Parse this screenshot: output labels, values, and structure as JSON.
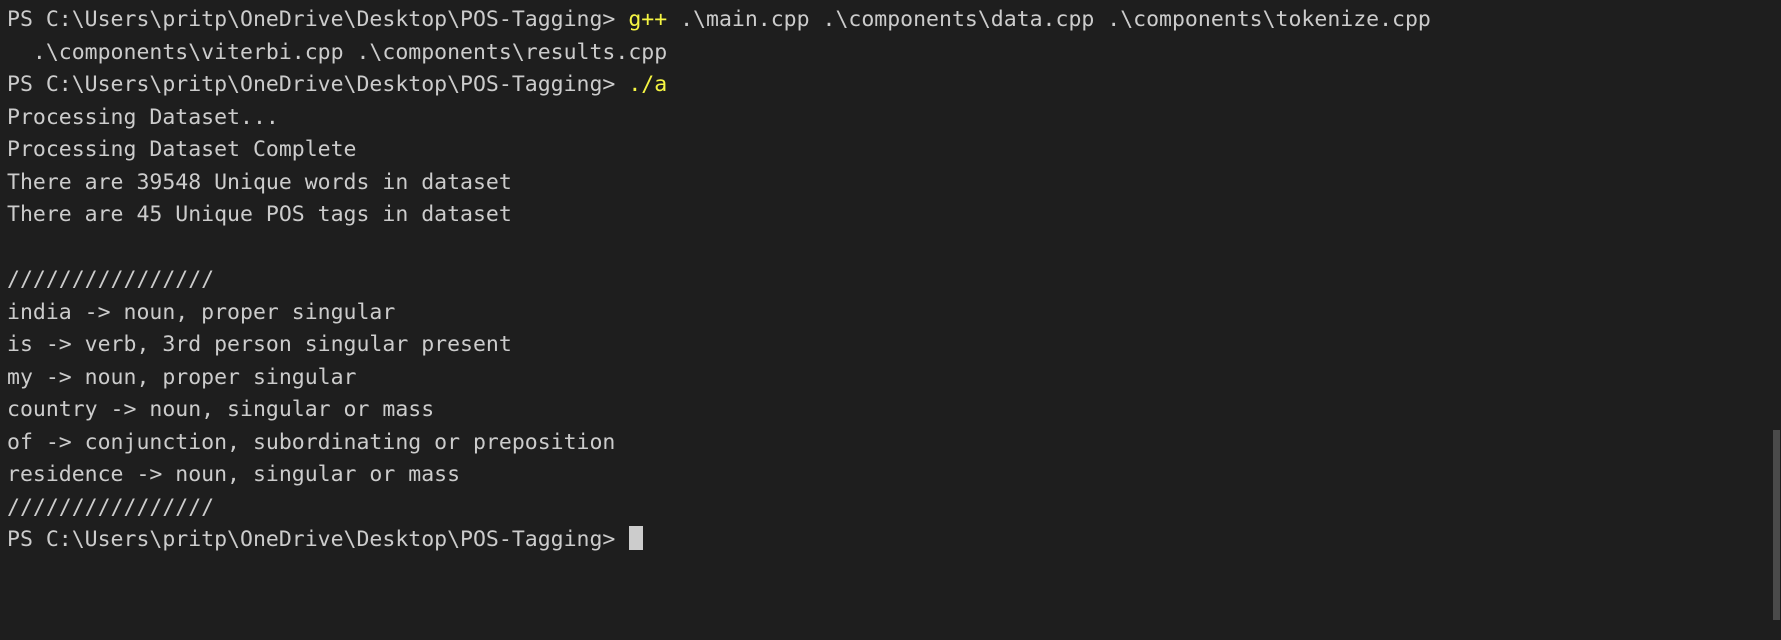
{
  "terminal": {
    "shell": "PowerShell",
    "prompt": "PS C:\\Users\\pritp\\OneDrive\\Desktop\\POS-Tagging>",
    "colors": {
      "background": "#1e1e1e",
      "foreground": "#cccccc",
      "command": "#f5f543",
      "cursor": "#cccccc",
      "scrollbar": "#4a4a4a"
    },
    "cursor": {
      "shape": "block",
      "visible": true
    },
    "lines": [
      {
        "type": "prompt",
        "prompt": "PS C:\\Users\\pritp\\OneDrive\\Desktop\\POS-Tagging> ",
        "command": "g++",
        "args": " .\\main.cpp .\\components\\data.cpp .\\components\\tokenize.cpp"
      },
      {
        "type": "output",
        "text": "  .\\components\\viterbi.cpp .\\components\\results.cpp"
      },
      {
        "type": "prompt",
        "prompt": "PS C:\\Users\\pritp\\OneDrive\\Desktop\\POS-Tagging> ",
        "command": "./a",
        "args": ""
      },
      {
        "type": "output",
        "text": "Processing Dataset..."
      },
      {
        "type": "output",
        "text": "Processing Dataset Complete"
      },
      {
        "type": "output",
        "text": "There are 39548 Unique words in dataset"
      },
      {
        "type": "output",
        "text": "There are 45 Unique POS tags in dataset"
      },
      {
        "type": "blank",
        "text": ""
      },
      {
        "type": "divider",
        "text": "////////////////"
      },
      {
        "type": "output",
        "text": "india -> noun, proper singular"
      },
      {
        "type": "output",
        "text": "is -> verb, 3rd person singular present"
      },
      {
        "type": "output",
        "text": "my -> noun, proper singular"
      },
      {
        "type": "output",
        "text": "country -> noun, singular or mass"
      },
      {
        "type": "output",
        "text": "of -> conjunction, subordinating or preposition"
      },
      {
        "type": "output",
        "text": "residence -> noun, singular or mass"
      },
      {
        "type": "divider",
        "text": "////////////////"
      },
      {
        "type": "prompt-cursor",
        "prompt": "PS C:\\Users\\pritp\\OneDrive\\Desktop\\POS-Tagging> ",
        "command": "",
        "args": ""
      }
    ]
  },
  "stats": {
    "unique_words": "39548",
    "unique_pos_tags": "45"
  },
  "tagged_tokens": [
    {
      "word": "india",
      "arrow": "->",
      "tag": "noun, proper singular"
    },
    {
      "word": "is",
      "arrow": "->",
      "tag": "verb, 3rd person singular present"
    },
    {
      "word": "my",
      "arrow": "->",
      "tag": "noun, proper singular"
    },
    {
      "word": "country",
      "arrow": "->",
      "tag": "noun, singular or mass"
    },
    {
      "word": "of",
      "arrow": "->",
      "tag": "conjunction, subordinating or preposition"
    },
    {
      "word": "residence",
      "arrow": "->",
      "tag": "noun, singular or mass"
    }
  ]
}
